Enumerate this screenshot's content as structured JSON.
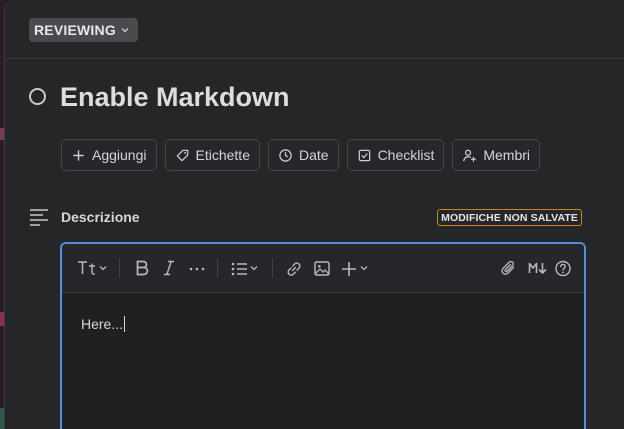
{
  "card": {
    "status": "REVIEWING",
    "title": "Enable Markdown"
  },
  "actions": [
    {
      "label": "Aggiungi",
      "icon": "plus-icon"
    },
    {
      "label": "Etichette",
      "icon": "tag-icon"
    },
    {
      "label": "Date",
      "icon": "clock-icon"
    },
    {
      "label": "Checklist",
      "icon": "checkbox-icon"
    },
    {
      "label": "Membri",
      "icon": "user-plus-icon"
    }
  ],
  "description": {
    "label": "Descrizione",
    "unsaved_badge": "MODIFICHE NON SALVATE",
    "content": "Here..."
  },
  "toolbar": {
    "items": [
      "text-style-icon",
      "bold-icon",
      "italic-icon",
      "more-icon",
      "list-icon",
      "link-icon",
      "image-icon",
      "insert-plus-icon",
      "attachment-icon",
      "markdown-icon",
      "help-icon"
    ]
  },
  "colors": {
    "accent": "#4f8fde",
    "warning_border": "#c9861d",
    "background": "#252628"
  }
}
